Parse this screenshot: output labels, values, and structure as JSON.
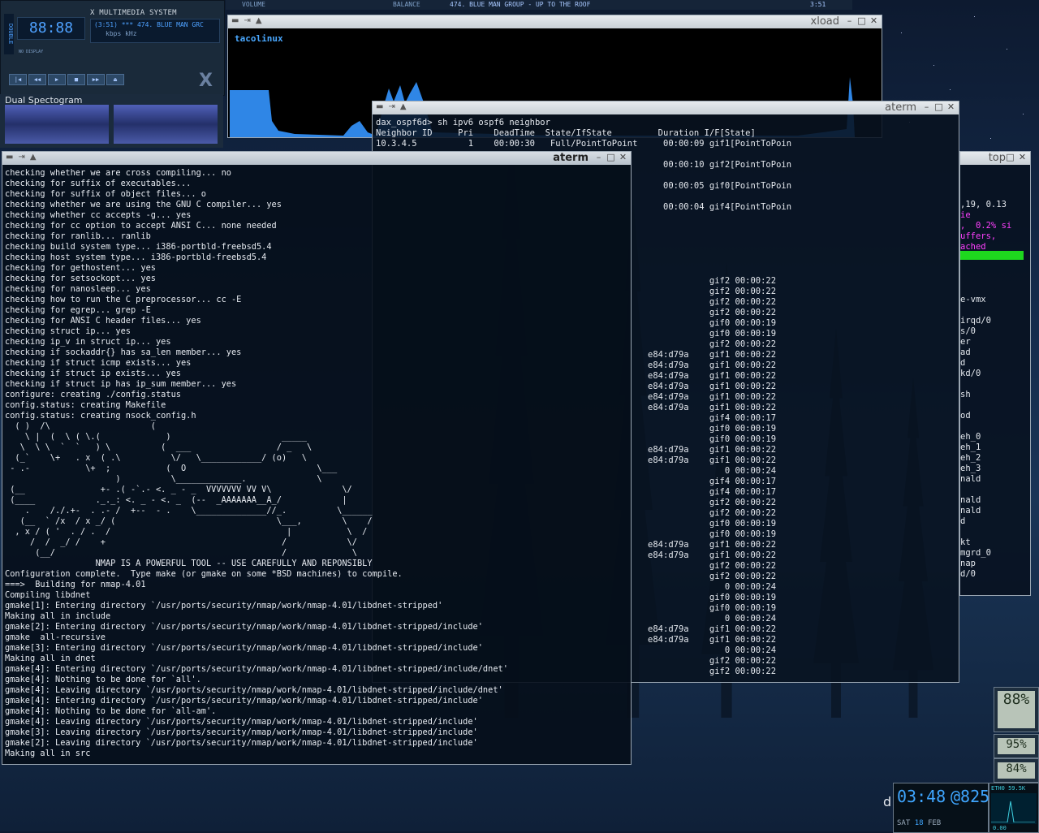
{
  "xmms": {
    "title": "X MULTIMEDIA SYSTEM",
    "time": "88:88",
    "info_line1": "(3:51)   ***  474. BLUE MAN GRC",
    "info_line2": "kbps    kHz",
    "buttons": [
      "|◀",
      "◀◀",
      "▶",
      "■",
      "▶▶",
      "⏏"
    ],
    "side_label": "DOUBLE",
    "side_caption": "NO DISPLAY"
  },
  "spectrogram": {
    "label": "Dual Spectogram"
  },
  "topbar": {
    "volume": "VOLUME",
    "balance": "BALANCE",
    "track": "474. BLUE MAN GROUP - UP TO THE ROOF",
    "time": "3:51"
  },
  "xload": {
    "title": "xload",
    "host": "tacolinux"
  },
  "aterm_ospf": {
    "title": "aterm",
    "lines": [
      "dax_ospf6d> sh ipv6 ospf6 neighbor",
      "Neighbor ID     Pri    DeadTime  State/IfState         Duration I/F[State]",
      "10.3.4.5          1    00:00:30   Full/PointToPoint     00:00:09 gif1[PointToPoin",
      "",
      "                                                        00:00:10 gif2[PointToPoin",
      "",
      "                                                        00:00:05 gif0[PointToPoin",
      "",
      "                                                        00:00:04 gif4[PointToPoin",
      "",
      "",
      "",
      "",
      "",
      "",
      "                                                                 gif2 00:00:22",
      "                                                                 gif2 00:00:22",
      "                                                                 gif2 00:00:22",
      "                                                                 gif2 00:00:22",
      "                                                                 gif0 00:00:19",
      "                                                                 gif0 00:00:19",
      "                                                                 gif2 00:00:22",
      "                                                     e84:d79a    gif1 00:00:22",
      "                                                     e84:d79a    gif1 00:00:22",
      "                                                     e84:d79a    gif1 00:00:22",
      "                                                     e84:d79a    gif1 00:00:22",
      "                                                     e84:d79a    gif1 00:00:22",
      "                                                     e84:d79a    gif1 00:00:22",
      "                                                                 gif4 00:00:17",
      "                                                                 gif0 00:00:19",
      "                                                                 gif0 00:00:19",
      "                                                     e84:d79a    gif1 00:00:22",
      "                                                     e84:d79a    gif1 00:00:22",
      "                                                                    0 00:00:24",
      "                                                                 gif4 00:00:17",
      "                                                                 gif4 00:00:17",
      "                                                                 gif2 00:00:22",
      "                                                                 gif2 00:00:22",
      "                                                                 gif0 00:00:19",
      "                                                                 gif0 00:00:19",
      "                                                     e84:d79a    gif1 00:00:22",
      "                                                     e84:d79a    gif1 00:00:22",
      "                                                                 gif2 00:00:22",
      "                                                                 gif2 00:00:22",
      "                                                                    0 00:00:24",
      "                                                                 gif0 00:00:19",
      "                                                                 gif0 00:00:19",
      "                                                                    0 00:00:24",
      "                                                     e84:d79a    gif1 00:00:22",
      "                                                     e84:d79a    gif1 00:00:22",
      "                                                                    0 00:00:24",
      "                                                                 gif2 00:00:22",
      "                                                                 gif2 00:00:22"
    ]
  },
  "top": {
    "title": "top",
    "lines": [
      ",19, 0.13",
      "ie",
      ",  0.2% si",
      "uffers,",
      "ached",
      "",
      "",
      "",
      "",
      "e-vmx",
      "",
      "irqd/0",
      "s/0",
      "er",
      "ad",
      "d",
      "kd/0",
      "",
      "sh",
      "",
      "od",
      "",
      "eh_0",
      "eh_1",
      "eh_2",
      "eh_3",
      "nald",
      "",
      "nald",
      "nald",
      "d",
      "",
      "kt",
      "mgrd_0",
      "nap",
      "d/0"
    ]
  },
  "aterm_build": {
    "title": "aterm",
    "lines": [
      "checking whether we are cross compiling... no",
      "checking for suffix of executables...",
      "checking for suffix of object files... o",
      "checking whether we are using the GNU C compiler... yes",
      "checking whether cc accepts -g... yes",
      "checking for cc option to accept ANSI C... none needed",
      "checking for ranlib... ranlib",
      "checking build system type... i386-portbld-freebsd5.4",
      "checking host system type... i386-portbld-freebsd5.4",
      "checking for gethostent... yes",
      "checking for setsockopt... yes",
      "checking for nanosleep... yes",
      "checking how to run the C preprocessor... cc -E",
      "checking for egrep... grep -E",
      "checking for ANSI C header files... yes",
      "checking struct ip... yes",
      "checking ip_v in struct ip... yes",
      "checking if sockaddr{} has sa_len member... yes",
      "checking if struct icmp exists... yes",
      "checking if struct ip exists... yes",
      "checking if struct ip has ip_sum member... yes",
      "configure: creating ./config.status",
      "config.status: creating Makefile",
      "config.status: creating nsock_config.h",
      "  ( )  /\\                    (",
      "    \\ |  (  \\ ( \\.(             )                      _____",
      "   \\  \\ \\  `  `   ) \\          (  ___                 / _   \\",
      "  (_`    \\+   . x  ( .\\          \\/   \\____________/ (o)   \\",
      " - .-           \\+  ;           (  O                          \\___",
      "                      )          \\_____________.              \\",
      " (__               +- .( -`.- <. _ - _  VVVVVVV VV V\\              \\/",
      " (____            ._._: <. _ - <. _  (--  _AAAAAAA__A_/            |",
      "    .    /./.+-  . .- /  +--  - .    \\______________//_.          \\______",
      "   (__  ` /x  / x _/ (                                \\___,        \\    /",
      "  , x / ( '  . / .  /                                   |           \\  /",
      "     /  /  _/ /    +                                   /            \\/",
      "      (__/                                             /             \\",
      "                  NMAP IS A POWERFUL TOOL -- USE CAREFULLY AND REPONSIBLY",
      "Configuration complete.  Type make (or gmake on some *BSD machines) to compile.",
      "===>  Building for nmap-4.01",
      "Compiling libdnet",
      "gmake[1]: Entering directory `/usr/ports/security/nmap/work/nmap-4.01/libdnet-stripped'",
      "Making all in include",
      "gmake[2]: Entering directory `/usr/ports/security/nmap/work/nmap-4.01/libdnet-stripped/include'",
      "gmake  all-recursive",
      "gmake[3]: Entering directory `/usr/ports/security/nmap/work/nmap-4.01/libdnet-stripped/include'",
      "Making all in dnet",
      "gmake[4]: Entering directory `/usr/ports/security/nmap/work/nmap-4.01/libdnet-stripped/include/dnet'",
      "gmake[4]: Nothing to be done for `all'.",
      "gmake[4]: Leaving directory `/usr/ports/security/nmap/work/nmap-4.01/libdnet-stripped/include/dnet'",
      "gmake[4]: Entering directory `/usr/ports/security/nmap/work/nmap-4.01/libdnet-stripped/include'",
      "gmake[4]: Nothing to be done for `all-am'.",
      "gmake[4]: Leaving directory `/usr/ports/security/nmap/work/nmap-4.01/libdnet-stripped/include'",
      "gmake[3]: Leaving directory `/usr/ports/security/nmap/work/nmap-4.01/libdnet-stripped/include'",
      "gmake[2]: Leaving directory `/usr/ports/security/nmap/work/nmap-4.01/libdnet-stripped/include'",
      "Making all in src"
    ]
  },
  "dock": {
    "cpu1": "88%",
    "cpu2": "95%",
    "cpu3": "84%",
    "clock_time": "03:48",
    "clock_extra": "@825",
    "clock_day": "SAT",
    "clock_date": "18",
    "clock_month": "FEB",
    "net_label": "ETH0",
    "net_in": "59.5K",
    "net_out": "0.00",
    "desktop_letter": "d"
  }
}
